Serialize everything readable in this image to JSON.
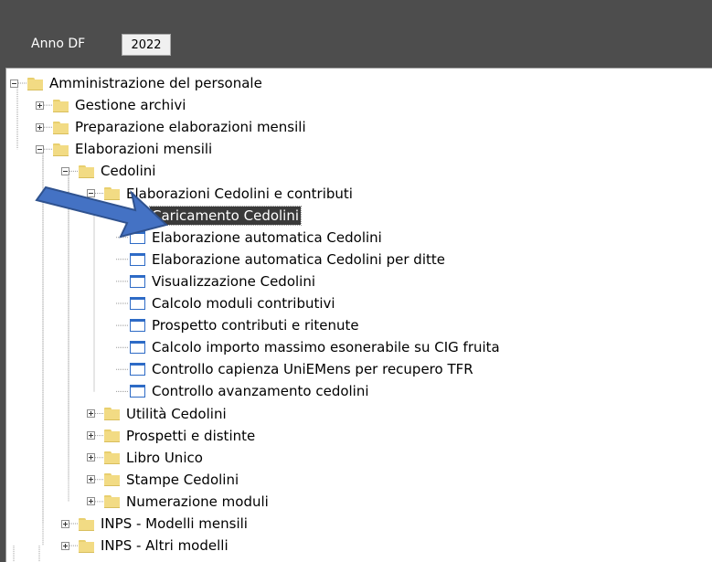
{
  "header": {
    "year_label": "Anno DF",
    "year_value": "2022"
  },
  "tree": {
    "items": [
      {
        "label": "Amministrazione del personale",
        "level": 0,
        "type": "folder",
        "expander": "minus"
      },
      {
        "label": "Gestione archivi",
        "level": 1,
        "type": "folder",
        "expander": "plus"
      },
      {
        "label": "Preparazione elaborazioni mensili",
        "level": 1,
        "type": "folder",
        "expander": "plus"
      },
      {
        "label": "Elaborazioni mensili",
        "level": 1,
        "type": "folder",
        "expander": "minus"
      },
      {
        "label": "Cedolini",
        "level": 2,
        "type": "folder",
        "expander": "minus"
      },
      {
        "label": "Elaborazioni Cedolini e contributi",
        "level": 3,
        "type": "folder",
        "expander": "minus"
      },
      {
        "label": "Caricamento Cedolini",
        "level": 4,
        "type": "doc",
        "selected": true
      },
      {
        "label": "Elaborazione automatica Cedolini",
        "level": 4,
        "type": "doc"
      },
      {
        "label": "Elaborazione automatica Cedolini per ditte",
        "level": 4,
        "type": "doc"
      },
      {
        "label": "Visualizzazione Cedolini",
        "level": 4,
        "type": "doc"
      },
      {
        "label": "Calcolo moduli contributivi",
        "level": 4,
        "type": "doc"
      },
      {
        "label": "Prospetto contributi e ritenute",
        "level": 4,
        "type": "doc"
      },
      {
        "label": "Calcolo importo massimo esonerabile su CIG fruita",
        "level": 4,
        "type": "doc"
      },
      {
        "label": "Controllo capienza UniEMens per recupero TFR",
        "level": 4,
        "type": "doc"
      },
      {
        "label": "Controllo avanzamento cedolini",
        "level": 4,
        "type": "doc"
      },
      {
        "label": "Utilità Cedolini",
        "level": 3,
        "type": "folder",
        "expander": "plus"
      },
      {
        "label": "Prospetti e distinte",
        "level": 3,
        "type": "folder",
        "expander": "plus"
      },
      {
        "label": "Libro Unico",
        "level": 3,
        "type": "folder",
        "expander": "plus"
      },
      {
        "label": "Stampe Cedolini",
        "level": 3,
        "type": "folder",
        "expander": "plus"
      },
      {
        "label": "Numerazione moduli",
        "level": 3,
        "type": "folder",
        "expander": "plus"
      },
      {
        "label": "INPS - Modelli mensili",
        "level": 2,
        "type": "folder",
        "expander": "plus"
      },
      {
        "label": "INPS - Altri modelli",
        "level": 2,
        "type": "folder",
        "expander": "plus"
      }
    ]
  },
  "annotation": {
    "arrow_color": "#4472c4",
    "arrow_outline": "#2f528f",
    "points_to": "Caricamento Cedolini"
  }
}
